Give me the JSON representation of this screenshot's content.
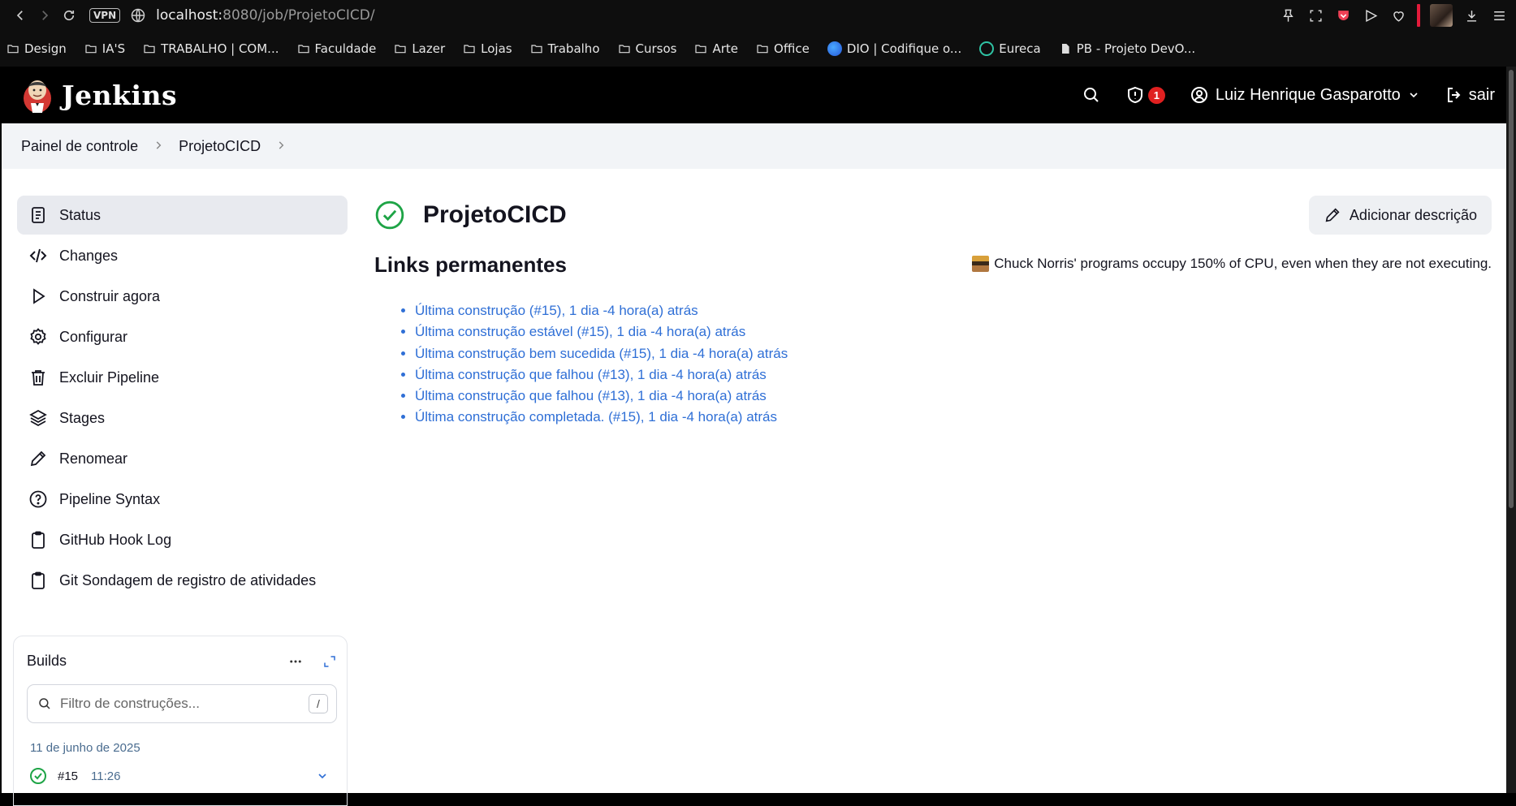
{
  "browser": {
    "url_host": "localhost:",
    "url_path": "8080/job/ProjetoCICD/",
    "vpn_label": "VPN",
    "bookmarks": [
      {
        "label": "Design",
        "icon": "folder-icon"
      },
      {
        "label": "IA'S",
        "icon": "folder-icon"
      },
      {
        "label": "TRABALHO | COM...",
        "icon": "folder-icon"
      },
      {
        "label": "Faculdade",
        "icon": "folder-icon"
      },
      {
        "label": "Lazer",
        "icon": "folder-icon"
      },
      {
        "label": "Lojas",
        "icon": "folder-icon"
      },
      {
        "label": "Trabalho",
        "icon": "folder-icon"
      },
      {
        "label": "Cursos",
        "icon": "folder-icon"
      },
      {
        "label": "Arte",
        "icon": "folder-icon"
      },
      {
        "label": "Office",
        "icon": "folder-icon"
      },
      {
        "label": "DIO | Codifique o...",
        "icon": "dio-icon"
      },
      {
        "label": "Eureca",
        "icon": "eureca-icon"
      },
      {
        "label": "PB - Projeto DevO...",
        "icon": "file-icon"
      }
    ]
  },
  "header": {
    "brand": "Jenkins",
    "security_badge_count": "1",
    "user_name": "Luiz Henrique Gasparotto",
    "logout_label": "sair"
  },
  "breadcrumb": {
    "items": [
      "Painel de controle",
      "ProjetoCICD"
    ]
  },
  "sidebar": {
    "items": [
      {
        "label": "Status",
        "icon": "notepad-icon"
      },
      {
        "label": "Changes",
        "icon": "code-icon"
      },
      {
        "label": "Construir agora",
        "icon": "play-icon"
      },
      {
        "label": "Configurar",
        "icon": "gear-icon"
      },
      {
        "label": "Excluir Pipeline",
        "icon": "trash-icon"
      },
      {
        "label": "Stages",
        "icon": "layers-icon"
      },
      {
        "label": "Renomear",
        "icon": "pencil-icon"
      },
      {
        "label": "Pipeline Syntax",
        "icon": "help-icon"
      },
      {
        "label": "GitHub Hook Log",
        "icon": "clipboard-icon"
      },
      {
        "label": "Git Sondagem de registro de atividades",
        "icon": "clipboard-icon"
      }
    ]
  },
  "builds": {
    "title": "Builds",
    "filter_placeholder": "Filtro de construções...",
    "filter_shortcut": "/",
    "date": "11 de junho de 2025",
    "rows": [
      {
        "number": "#15",
        "time": "11:26"
      }
    ]
  },
  "main": {
    "job_title": "ProjetoCICD",
    "add_description_label": "Adicionar descrição",
    "permalinks_title": "Links permanentes",
    "quote": "Chuck Norris' programs occupy 150% of CPU, even when they are not executing.",
    "permalinks": [
      "Última construção (#15), 1 dia -4 hora(a) atrás",
      "Última construção estável (#15), 1 dia -4 hora(a) atrás",
      "Última construção bem sucedida (#15), 1 dia -4 hora(a) atrás",
      "Última construção que falhou (#13), 1 dia -4 hora(a) atrás",
      "Última construção que falhou (#13), 1 dia -4 hora(a) atrás",
      "Última construção completada. (#15), 1 dia -4 hora(a) atrás"
    ]
  },
  "colors": {
    "link": "#2f6fd6",
    "success": "#1ea446",
    "badge": "#e02020",
    "header_bg": "#000000"
  }
}
